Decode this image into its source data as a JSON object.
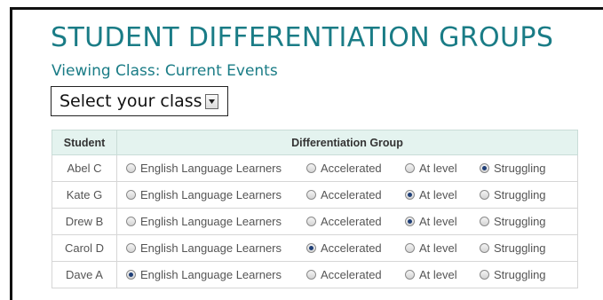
{
  "header": {
    "title": "STUDENT DIFFERENTIATION GROUPS",
    "viewing": "Viewing Class: Current Events"
  },
  "class_select": {
    "selected": "Select your class",
    "icon": "chevron-down-icon"
  },
  "table": {
    "headers": [
      "Student",
      "Differentiation Group"
    ],
    "options": [
      "English Language Learners",
      "Accelerated",
      "At level",
      "Struggling"
    ],
    "rows": [
      {
        "student": "Abel  C",
        "selected": "Struggling"
      },
      {
        "student": "Kate  G",
        "selected": "At level"
      },
      {
        "student": "Drew  B",
        "selected": "At level"
      },
      {
        "student": "Carol  D",
        "selected": "Accelerated"
      },
      {
        "student": "Dave  A",
        "selected": "English Language Learners"
      }
    ]
  },
  "colors": {
    "title": "#1a7c86",
    "header_bg": "#e4f3ef",
    "radio_dot": "#1f3f77"
  }
}
